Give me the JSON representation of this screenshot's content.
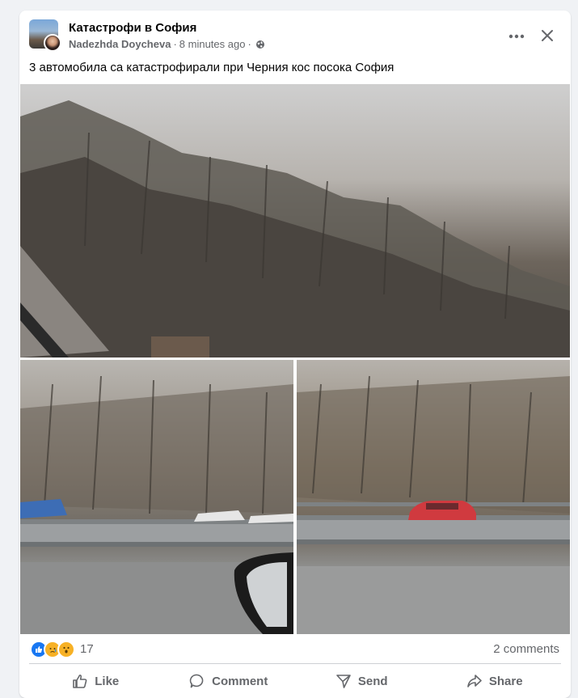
{
  "post": {
    "group_name": "Катастрофи в София",
    "author": "Nadezhda Doycheva",
    "separator": "·",
    "time_ago": "8 minutes ago",
    "privacy_icon": "globe-icon",
    "text": "3 автомобила са катастрофирали при Черния кос посока София"
  },
  "photos": [
    {
      "description": "Foggy wooded hillside through car window"
    },
    {
      "description": "Road with guardrail and cars, wooded slope"
    },
    {
      "description": "Red car on highway near wooded slope"
    }
  ],
  "engagement": {
    "reaction_icons": [
      "like-reaction-icon",
      "sad-reaction-icon",
      "wow-reaction-icon"
    ],
    "reaction_count": "17",
    "comments": "2 comments"
  },
  "actions": {
    "like": "Like",
    "comment": "Comment",
    "send": "Send",
    "share": "Share"
  },
  "colors": {
    "brand_blue": "#1877f2",
    "secondary_text": "#65676b",
    "background": "#f0f2f5"
  }
}
